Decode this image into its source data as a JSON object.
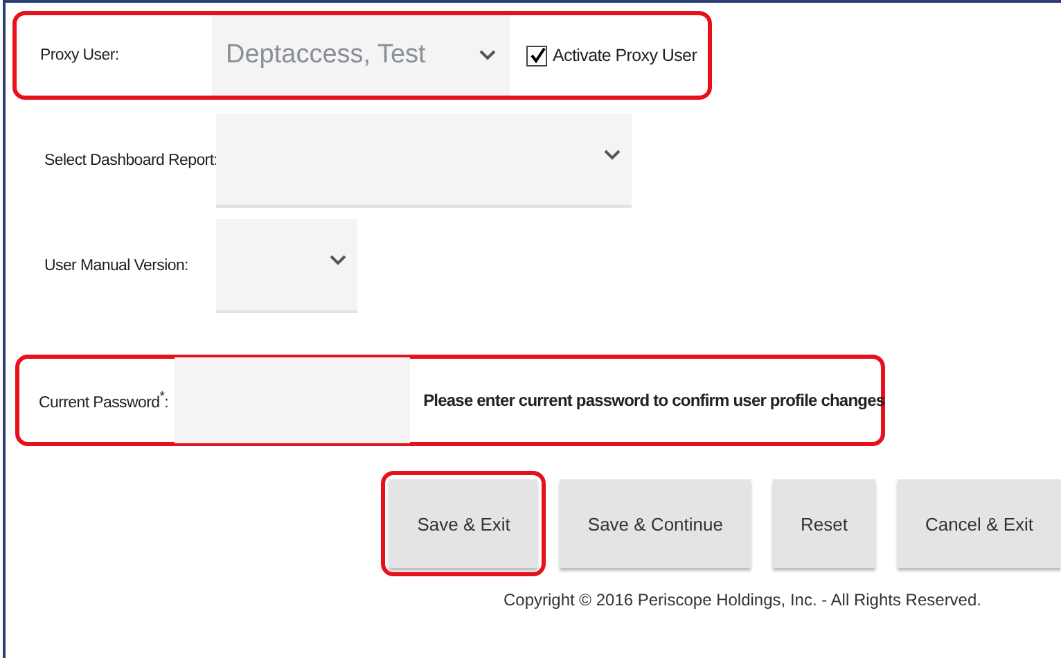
{
  "proxy_row": {
    "highlighted": true,
    "label": "Proxy User:",
    "value": "Deptaccess, Test",
    "checkbox": {
      "label": "Activate Proxy User",
      "checked": true
    }
  },
  "dashboard_row": {
    "label": "Select Dashboard Report:"
  },
  "manual_row": {
    "label": "User Manual Version:"
  },
  "password_row": {
    "highlighted": true,
    "label": "Current Password$^{*}$:",
    "hint": "Please enter current password to confirm user profile changes"
  },
  "buttons": [
    {
      "label": "Save & Exit",
      "highlighted": true
    },
    {
      "label": "Save & Continue",
      "highlighted": false
    },
    {
      "label": "Reset",
      "highlighted": false
    },
    {
      "label": "Cancel & Exit",
      "highlighted": false
    }
  ],
  "footer": "Copyright © 2016 Periscope Holdings, Inc. - All Rights Reserved."
}
